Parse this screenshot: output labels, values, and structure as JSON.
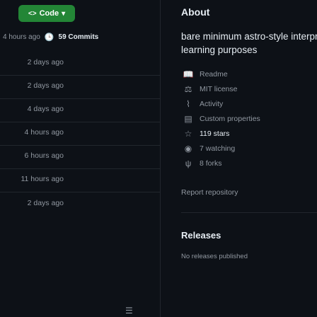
{
  "header": {
    "code_button_label": "Code",
    "about_title": "About"
  },
  "commits": {
    "time_ago": "4 hours ago",
    "count_label": "59 Commits"
  },
  "file_times": [
    "2 days ago",
    "2 days ago",
    "4 days ago",
    "4 hours ago",
    "6 hours ago",
    "11 hours ago",
    "2 days ago"
  ],
  "about": {
    "description_line1": "bare minimum astro-style interpr",
    "description_line2": "learning purposes"
  },
  "info_items": [
    {
      "icon": "book-icon",
      "label": "Readme",
      "strong": false
    },
    {
      "icon": "law-icon",
      "label": "MIT license",
      "strong": false
    },
    {
      "icon": "pulse-icon",
      "label": "Activity",
      "strong": false
    },
    {
      "icon": "properties-icon",
      "label": "Custom properties",
      "strong": false
    },
    {
      "icon": "star-icon",
      "label": "119 stars",
      "strong": true
    },
    {
      "icon": "eye-icon",
      "label": "7 watching",
      "strong": false
    },
    {
      "icon": "fork-icon",
      "label": "8 forks",
      "strong": false
    }
  ],
  "report_label": "Report repository",
  "releases": {
    "title": "Releases",
    "empty_text": "No releases published"
  },
  "colors": {
    "accent": "#238636",
    "bg": "#0d1117",
    "muted": "#9198a1"
  }
}
